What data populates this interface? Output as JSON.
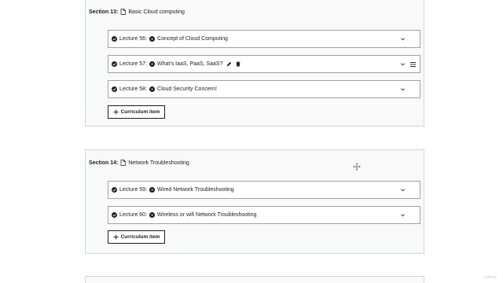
{
  "sections": [
    {
      "label": "Section 13:",
      "title": "Basic Cloud computing",
      "lectures": [
        {
          "label": "Lecture 56:",
          "title": "Concept of Cloud Computing"
        },
        {
          "label": "Lecture 57:",
          "title": "What's IaaS, PaaS, SaaS?"
        },
        {
          "label": "Lecture 58:",
          "title": "Cloud Security Concern!"
        }
      ],
      "add_button": "Curriculum item"
    },
    {
      "label": "Section 14:",
      "title": "Network Troubleshooting",
      "lectures": [
        {
          "label": "Lecture 59:",
          "title": "Wired Network Troubleshooting"
        },
        {
          "label": "Lecture 60:",
          "title": "Wireless or wifi Network Troubleshooting"
        }
      ],
      "add_button": "Curriculum item"
    }
  ],
  "watermark": "Udemy",
  "icons": {
    "section": "file-icon",
    "lecture_status": "check-circle-icon",
    "lecture_type": "play-circle-icon",
    "expand": "chevron-down-icon",
    "drag": "hamburger-menu-icon",
    "edit": "pencil-icon",
    "delete": "trash-icon",
    "add": "plus-icon",
    "cursor": "move-cursor-icon"
  },
  "colors": {
    "section_bg": "#f7f9fa",
    "border": "#d1d7dc",
    "text": "#1c1d1f"
  }
}
